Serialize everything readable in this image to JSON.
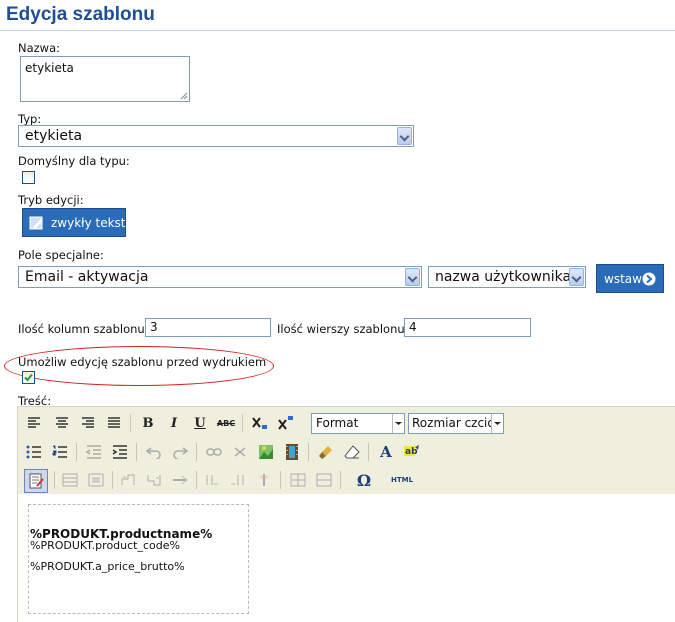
{
  "page": {
    "title": "Edycja szablonu"
  },
  "form": {
    "nazwa_label": "Nazwa:",
    "nazwa_value": "etykieta",
    "typ_label": "Typ:",
    "typ_value": "etykieta",
    "domyslny_label": "Domyślny dla typu:",
    "domyslny_checked": false,
    "tryb_label": "Tryb edycji:",
    "tryb_button": "zwykły tekst",
    "pole_label": "Pole specjalne:",
    "pole_value": "Email - aktywacja",
    "pole2_value": "nazwa użytkownika",
    "wstaw_button": "wstaw",
    "kolumn_label": "Ilość kolumn szablonu:",
    "kolumn_value": "3",
    "wierszy_label": "Ilość wierszy szablonu:",
    "wierszy_value": "4",
    "umozliw_label": "Umożliw edycję szablonu przed wydrukiem",
    "umozliw_checked": true,
    "tresc_label": "Treść:"
  },
  "editor": {
    "format_select": "Format",
    "size_select": "Rozmiar czcion",
    "html_button": "HTML",
    "content": [
      "%PRODUKT.productname%",
      "%PRODUKT.product_code%",
      "%PRODUKT.a_price_brutto%"
    ]
  },
  "colors": {
    "title": "#1f4f96",
    "button": "#2a6cb8",
    "highlight": "#d62020",
    "toolbar": "#efefde"
  }
}
